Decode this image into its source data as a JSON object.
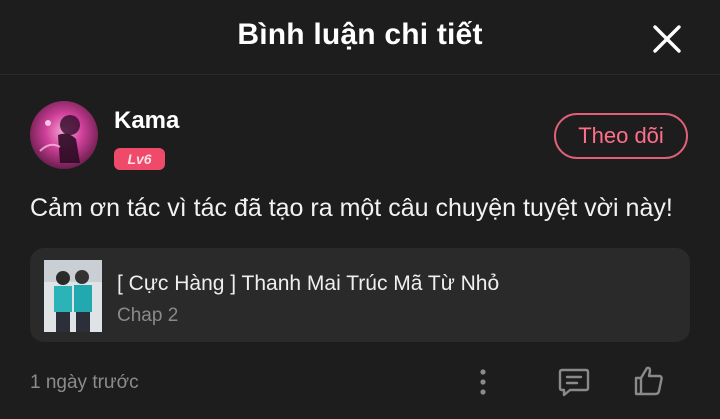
{
  "header": {
    "title": "Bình luận chi tiết"
  },
  "comment": {
    "username": "Kama",
    "level": "Lv6",
    "follow_label": "Theo dõi",
    "text": "Cảm ơn tác vì tác đã tạo ra một câu chuyện tuyệt vời này!",
    "timestamp": "1 ngày trước"
  },
  "chapter": {
    "series_title": "[ Cực Hàng ] Thanh Mai Trúc Mã Từ Nhỏ",
    "chapter_label": "Chap 2"
  },
  "icons": {
    "close": "close-icon",
    "more": "more-vertical-icon",
    "reply": "comment-icon",
    "like": "thumbs-up-icon"
  },
  "colors": {
    "background": "#1d1d1d",
    "card": "#2a2a2a",
    "accent": "#f04a6a",
    "follow_border": "#e0607a"
  }
}
